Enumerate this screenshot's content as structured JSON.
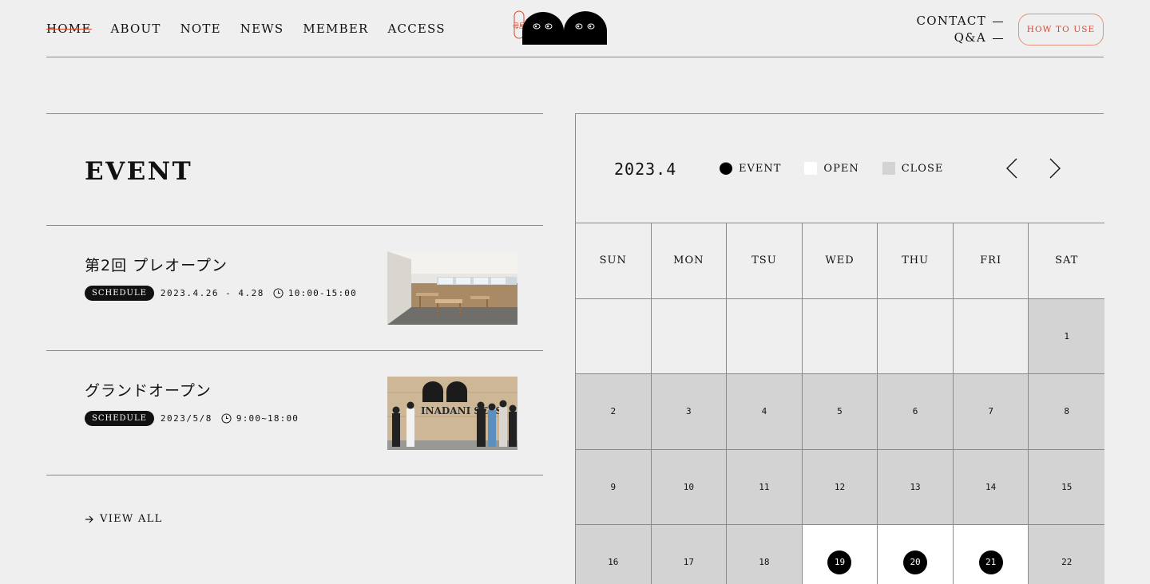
{
  "nav": {
    "items": [
      "HOME",
      "ABOUT",
      "NOTE",
      "NEWS",
      "MEMBER",
      "ACCESS"
    ],
    "active": "HOME"
  },
  "logo": {
    "seal_text": "母屋"
  },
  "header": {
    "contact_label": "CONTACT",
    "qa_label": "Q&A",
    "how_to_use_label": "HOW TO USE"
  },
  "events": {
    "title": "EVENT",
    "items": [
      {
        "title": "第2回 プレオープン",
        "badge": "SCHEDULE",
        "date": "2023.4.26 - 4.28",
        "time": "10:00-15:00",
        "image": "room-interior-photo"
      },
      {
        "title": "グランドオープン",
        "badge": "SCHEDULE",
        "date": "2023/5/8",
        "time": "9:00~18:00",
        "image": "group-photo",
        "image_sign": "INADANI SEES"
      }
    ],
    "view_all_label": "VIEW ALL"
  },
  "calendar": {
    "month": "2023.4",
    "legend": {
      "event": "EVENT",
      "open": "OPEN",
      "close": "CLOSE"
    },
    "weekdays": [
      "SUN",
      "MON",
      "TSU",
      "WED",
      "THU",
      "FRI",
      "SAT"
    ],
    "weeks": [
      [
        null,
        null,
        null,
        null,
        null,
        null,
        {
          "day": "1",
          "status": "close"
        }
      ],
      [
        {
          "day": "2",
          "status": "close"
        },
        {
          "day": "3",
          "status": "close"
        },
        {
          "day": "4",
          "status": "close"
        },
        {
          "day": "5",
          "status": "close"
        },
        {
          "day": "6",
          "status": "close"
        },
        {
          "day": "7",
          "status": "close"
        },
        {
          "day": "8",
          "status": "close"
        }
      ],
      [
        {
          "day": "9",
          "status": "close"
        },
        {
          "day": "10",
          "status": "close"
        },
        {
          "day": "11",
          "status": "close"
        },
        {
          "day": "12",
          "status": "close"
        },
        {
          "day": "13",
          "status": "close"
        },
        {
          "day": "14",
          "status": "close"
        },
        {
          "day": "15",
          "status": "close"
        }
      ],
      [
        {
          "day": "16",
          "status": "close"
        },
        {
          "day": "17",
          "status": "close"
        },
        {
          "day": "18",
          "status": "close"
        },
        {
          "day": "19",
          "status": "event"
        },
        {
          "day": "20",
          "status": "event"
        },
        {
          "day": "21",
          "status": "event"
        },
        {
          "day": "22",
          "status": "close"
        }
      ]
    ]
  },
  "colors": {
    "background": "#efefef",
    "accent": "#d9462d",
    "close": "#d3d3d3",
    "open": "#ffffff",
    "event": "#000000"
  }
}
